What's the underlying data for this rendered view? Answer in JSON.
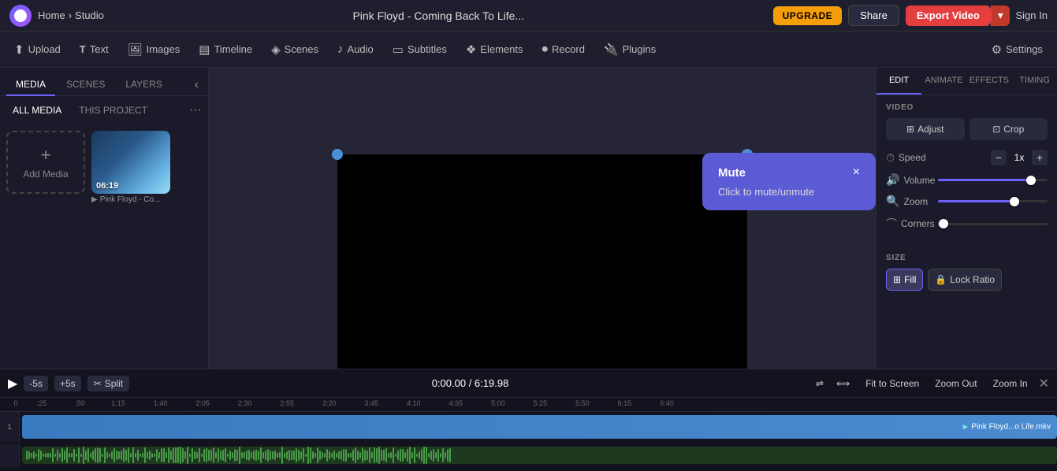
{
  "app": {
    "logo_alt": "Flexclip logo",
    "breadcrumb_home": "Home",
    "breadcrumb_sep": "›",
    "breadcrumb_studio": "Studio",
    "title": "Pink Floyd - Coming Back To Life...",
    "btn_upgrade": "UPGRADE",
    "btn_share": "Share",
    "btn_export": "Export Video",
    "btn_signin": "Sign In"
  },
  "toolbar": {
    "items": [
      {
        "id": "upload",
        "icon": "⬆",
        "label": "Upload"
      },
      {
        "id": "text",
        "icon": "T",
        "label": "Text"
      },
      {
        "id": "images",
        "icon": "🔍",
        "label": "Images"
      },
      {
        "id": "timeline",
        "icon": "▤",
        "label": "Timeline"
      },
      {
        "id": "scenes",
        "icon": "◈",
        "label": "Scenes"
      },
      {
        "id": "audio",
        "icon": "♪",
        "label": "Audio"
      },
      {
        "id": "subtitles",
        "icon": "▭",
        "label": "Subtitles"
      },
      {
        "id": "elements",
        "icon": "◉",
        "label": "Elements"
      },
      {
        "id": "record",
        "icon": "⏺",
        "label": "Record"
      },
      {
        "id": "plugins",
        "icon": "🔌",
        "label": "Plugins"
      },
      {
        "id": "settings",
        "icon": "⚙",
        "label": "Settings"
      }
    ]
  },
  "sidebar": {
    "tabs": [
      "MEDIA",
      "SCENES",
      "LAYERS"
    ],
    "active_tab": "MEDIA",
    "filters": [
      "ALL MEDIA",
      "THIS PROJECT"
    ],
    "active_filter": "ALL MEDIA",
    "add_media_label": "Add Media",
    "media_items": [
      {
        "duration": "06:19",
        "label": "Pink Floyd - Co...",
        "type": "video"
      }
    ]
  },
  "mute_tooltip": {
    "title": "Mute",
    "description": "Click to mute/unmute",
    "close_label": "×"
  },
  "right_panel": {
    "tabs": [
      "EDIT",
      "ANIMATE",
      "EFFECTS",
      "TIMING"
    ],
    "active_tab": "EDIT",
    "video_section_label": "VIDEO",
    "btn_adjust": "Adjust",
    "btn_crop": "Crop",
    "controls": [
      {
        "id": "speed",
        "label": "Speed",
        "icon": "⏱",
        "type": "speed",
        "value": "1x"
      },
      {
        "id": "volume",
        "label": "Volume",
        "icon": "🔊",
        "type": "slider",
        "fill_pct": 85,
        "thumb_pct": 85
      },
      {
        "id": "zoom",
        "label": "Zoom",
        "icon": "🔍",
        "type": "slider",
        "fill_pct": 70,
        "thumb_pct": 70
      },
      {
        "id": "corners",
        "label": "Corners",
        "icon": "⌒",
        "type": "slider",
        "fill_pct": 5,
        "thumb_pct": 5
      }
    ],
    "size_section_label": "SIZE",
    "btn_fill": "Fill",
    "btn_lock_ratio": "Lock Ratio"
  },
  "timeline": {
    "play_label": "▶",
    "skip_back": "-5s",
    "skip_fwd": "+5s",
    "split_label": "Split",
    "time_current": "0:00.00",
    "time_total": "6:19.98",
    "btn_fit_screen": "Fit to Screen",
    "btn_zoom_out": "Zoom Out",
    "btn_zoom_in": "Zoom In",
    "ruler_marks": [
      "0",
      ":25",
      ":50",
      "1:15",
      "1:40",
      "2:05",
      "2:30",
      "2:55",
      "3:20",
      "3:45",
      "4:10",
      "4:35",
      "5:00",
      "5:25",
      "5:50",
      "6:15",
      "6:40"
    ],
    "track_number": "1",
    "track_clip_label": "Pink Floyd...o Life.mkv"
  },
  "colors": {
    "accent": "#6c63ff",
    "upgrade_bg": "#f59e0b",
    "export_bg": "#e53e3e",
    "mute_bg": "#5b5bd6",
    "canvas_bg": "#000000",
    "handle_color": "#4a90d9"
  }
}
